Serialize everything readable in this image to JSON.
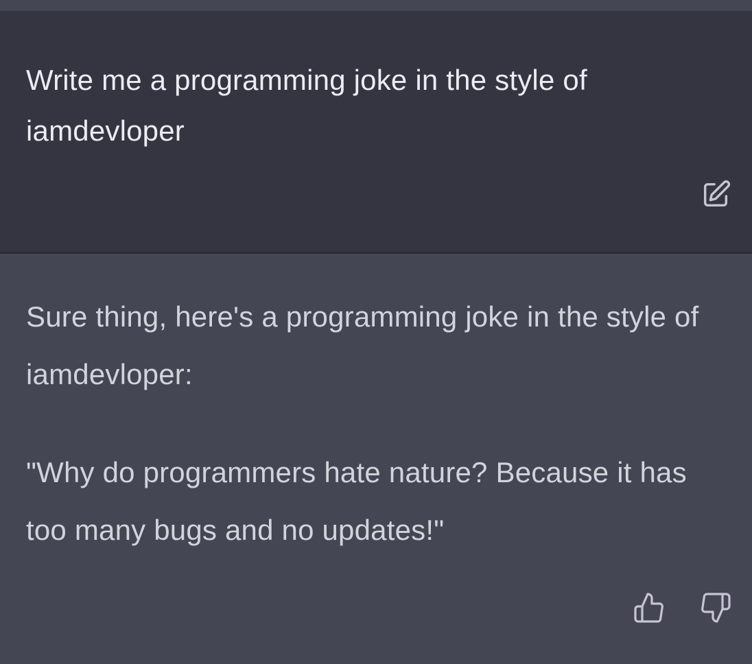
{
  "conversation": {
    "user_message": {
      "text": "Write me a programming joke in the style of iamdevloper",
      "edit_icon": "edit-icon"
    },
    "assistant_message": {
      "paragraphs": [
        "Sure thing, here's a programming joke in the style of iamdevloper:",
        "\"Why do programmers hate nature? Because it has too many bugs and no updates!\""
      ],
      "feedback_icons": [
        "thumbs-up-icon",
        "thumbs-down-icon"
      ]
    }
  },
  "colors": {
    "user_bg": "#343541",
    "assistant_bg": "#444654",
    "user_text": "#ececf1",
    "assistant_text": "#d1d5db",
    "icon": "#c5c5d2"
  }
}
